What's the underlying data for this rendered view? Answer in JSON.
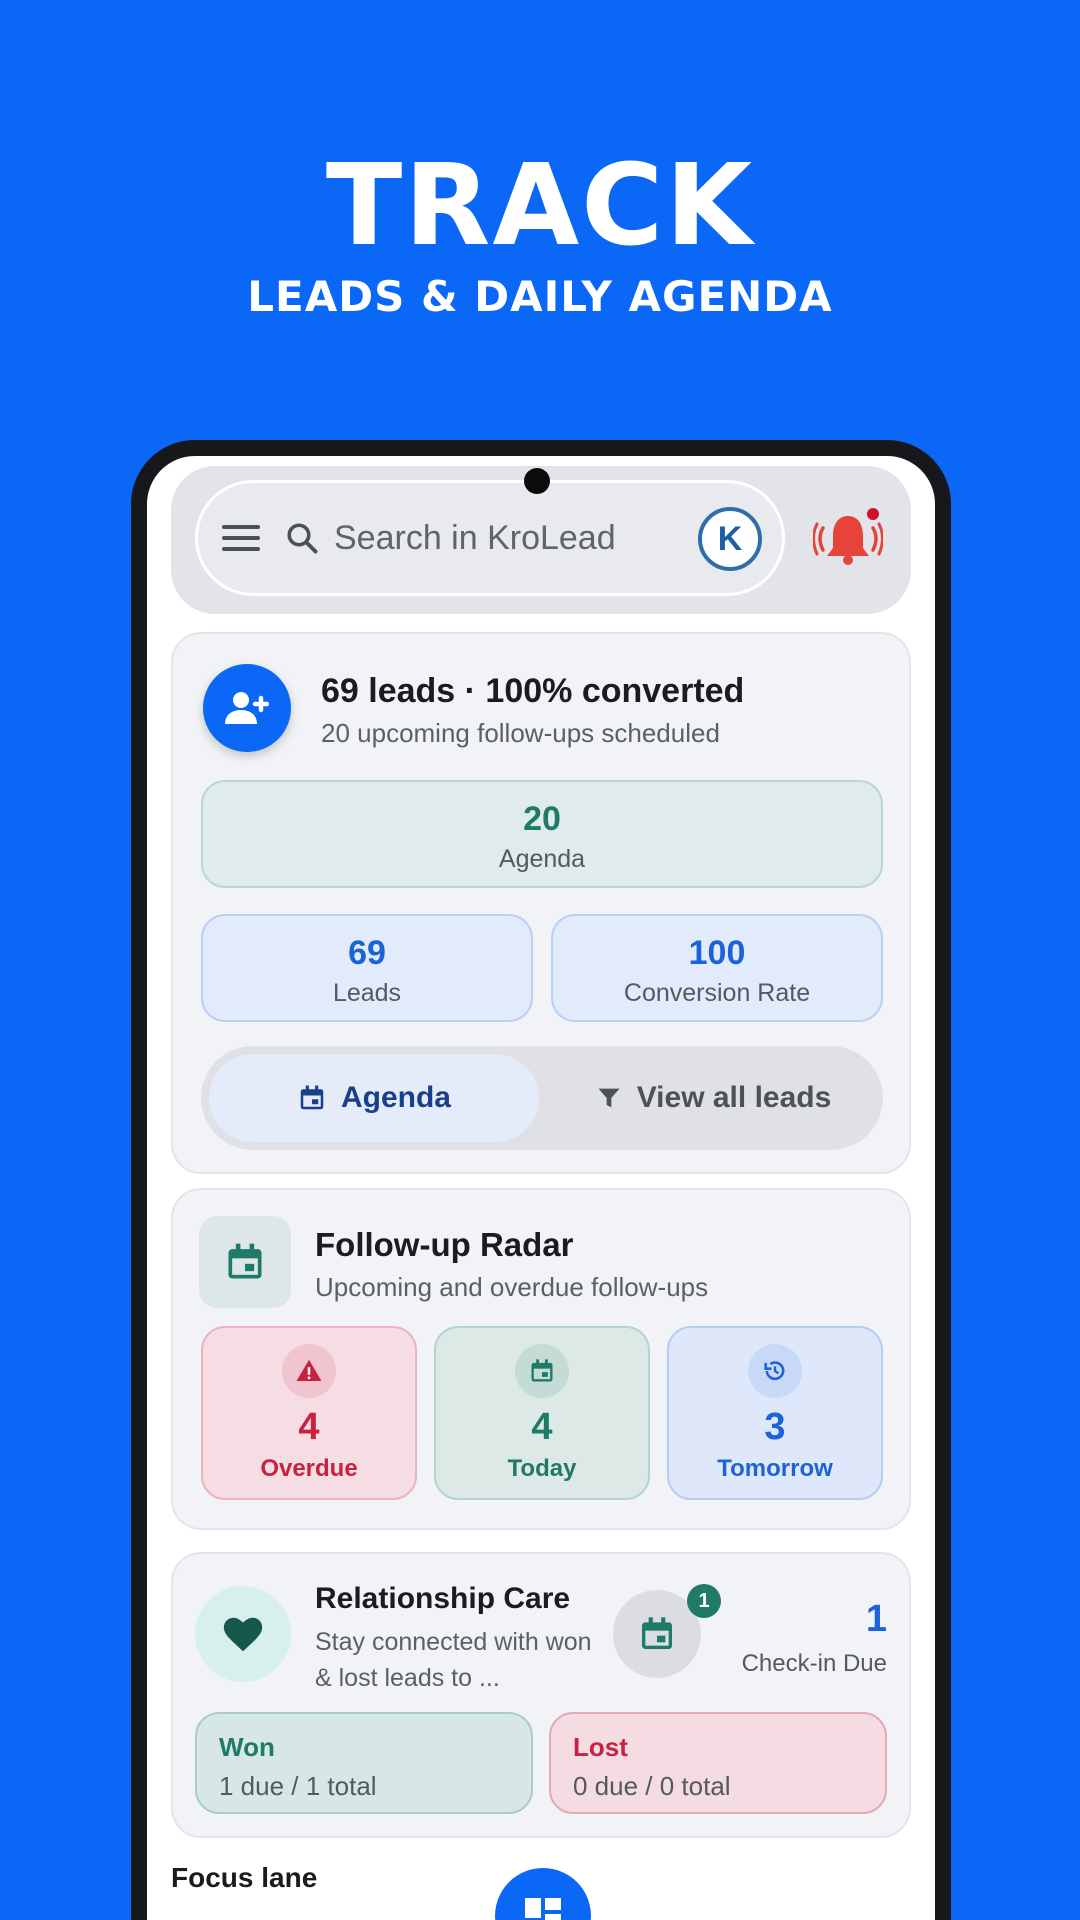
{
  "hero": {
    "title": "TRACK",
    "subtitle": "LEADS & DAILY AGENDA"
  },
  "appbar": {
    "search_placeholder": "Search in KroLead",
    "avatar_letter": "K"
  },
  "summary": {
    "title": "69 leads · 100% converted",
    "subtitle": "20 upcoming follow-ups scheduled",
    "agenda": {
      "value": "20",
      "label": "Agenda"
    },
    "leads": {
      "value": "69",
      "label": "Leads"
    },
    "conversion": {
      "value": "100",
      "label": "Conversion Rate"
    },
    "segments": {
      "agenda": "Agenda",
      "view_all": "View all leads"
    }
  },
  "radar": {
    "title": "Follow-up Radar",
    "subtitle": "Upcoming and overdue follow-ups",
    "overdue": {
      "value": "4",
      "label": "Overdue"
    },
    "today": {
      "value": "4",
      "label": "Today"
    },
    "tomorrow": {
      "value": "3",
      "label": "Tomorrow"
    }
  },
  "care": {
    "title": "Relationship Care",
    "subtitle": "Stay connected with won & lost leads to ...",
    "badge": "1",
    "checkin_value": "1",
    "checkin_label": "Check-in Due",
    "won": {
      "label": "Won",
      "detail": "1 due / 1 total"
    },
    "lost": {
      "label": "Lost",
      "detail": "0 due / 0 total"
    }
  },
  "focus_lane": "Focus lane",
  "colors": {
    "brand": "#0B67F5",
    "green": "#1f7a67",
    "red": "#c62340",
    "blue": "#1c63d7"
  }
}
